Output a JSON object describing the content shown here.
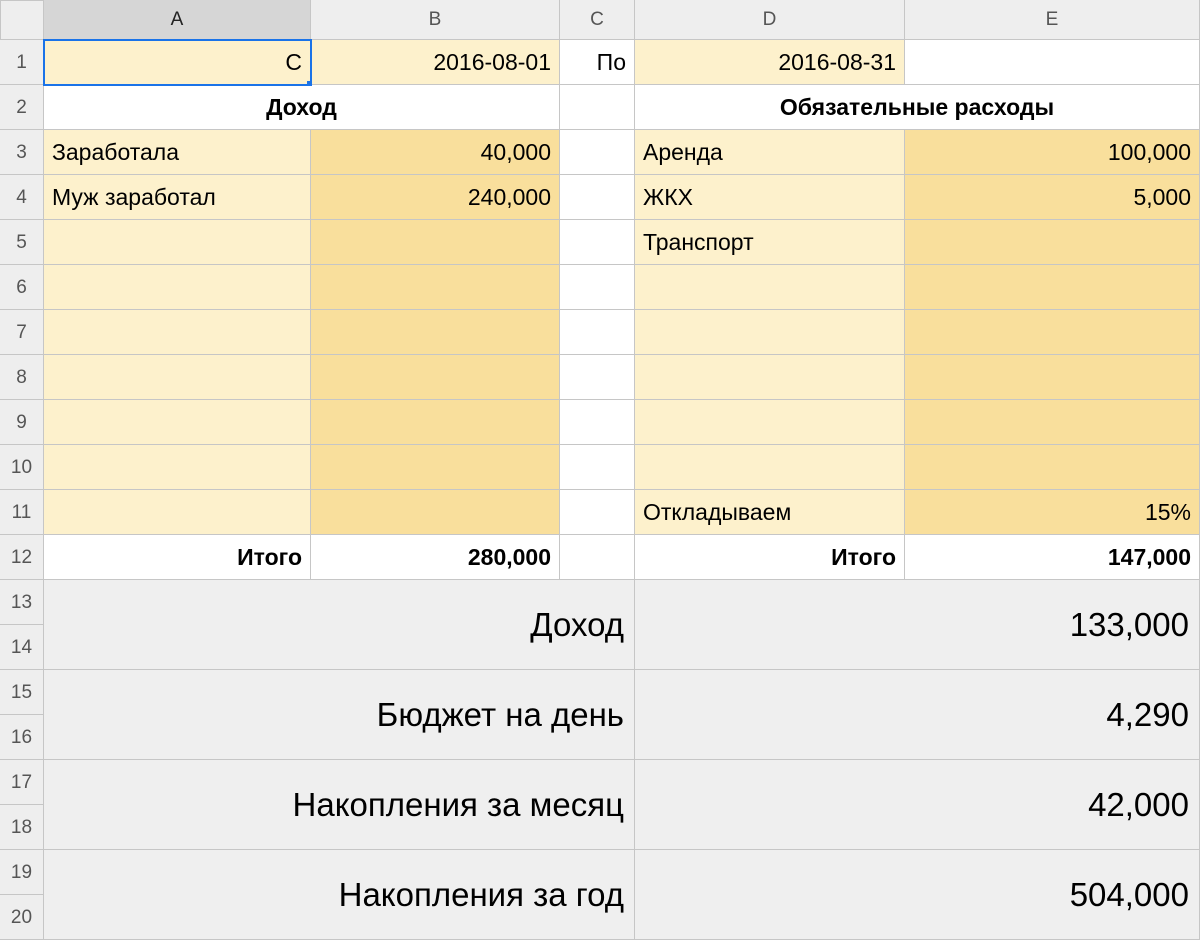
{
  "columns": [
    "A",
    "B",
    "C",
    "D",
    "E"
  ],
  "rows": [
    "1",
    "2",
    "3",
    "4",
    "5",
    "6",
    "7",
    "8",
    "9",
    "10",
    "11",
    "12",
    "13",
    "14",
    "15",
    "16",
    "17",
    "18",
    "19",
    "20"
  ],
  "period": {
    "from_label": "С",
    "from_date": "2016-08-01",
    "to_label": "По",
    "to_date": "2016-08-31"
  },
  "headers": {
    "income": "Доход",
    "expenses": "Обязательные расходы"
  },
  "income_items": [
    {
      "label": "Заработала",
      "value": "40,000"
    },
    {
      "label": "Муж заработал",
      "value": "240,000"
    }
  ],
  "expense_items": [
    {
      "label": "Аренда",
      "value": "100,000"
    },
    {
      "label": "ЖКХ",
      "value": "5,000"
    },
    {
      "label": "Транспорт",
      "value": ""
    }
  ],
  "savings_row": {
    "label": "Откладываем",
    "value": "15%"
  },
  "totals": {
    "label": "Итого",
    "income_total": "280,000",
    "expense_total": "147,000"
  },
  "summary": [
    {
      "label": "Доход",
      "value": "133,000"
    },
    {
      "label": "Бюджет на день",
      "value": "4,290"
    },
    {
      "label": "Накопления за месяц",
      "value": "42,000"
    },
    {
      "label": "Накопления за год",
      "value": "504,000"
    }
  ]
}
